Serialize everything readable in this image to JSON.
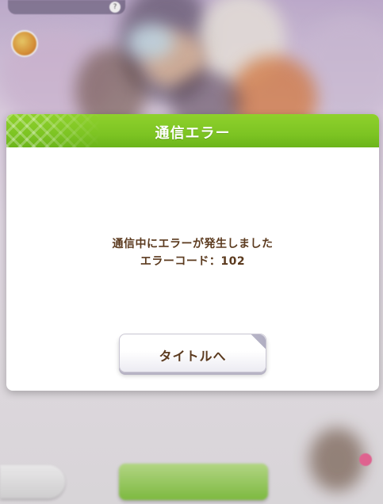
{
  "background": {
    "story_text": "",
    "back_label": "",
    "next_label": ""
  },
  "dialog": {
    "title": "通信エラー",
    "message_line1": "通信中にエラーが発生しました",
    "message_line2": "エラーコード：102",
    "button_label": "タイトルへ"
  },
  "colors": {
    "header_green": "#7dc423",
    "message_brown": "#5b3a1e"
  }
}
